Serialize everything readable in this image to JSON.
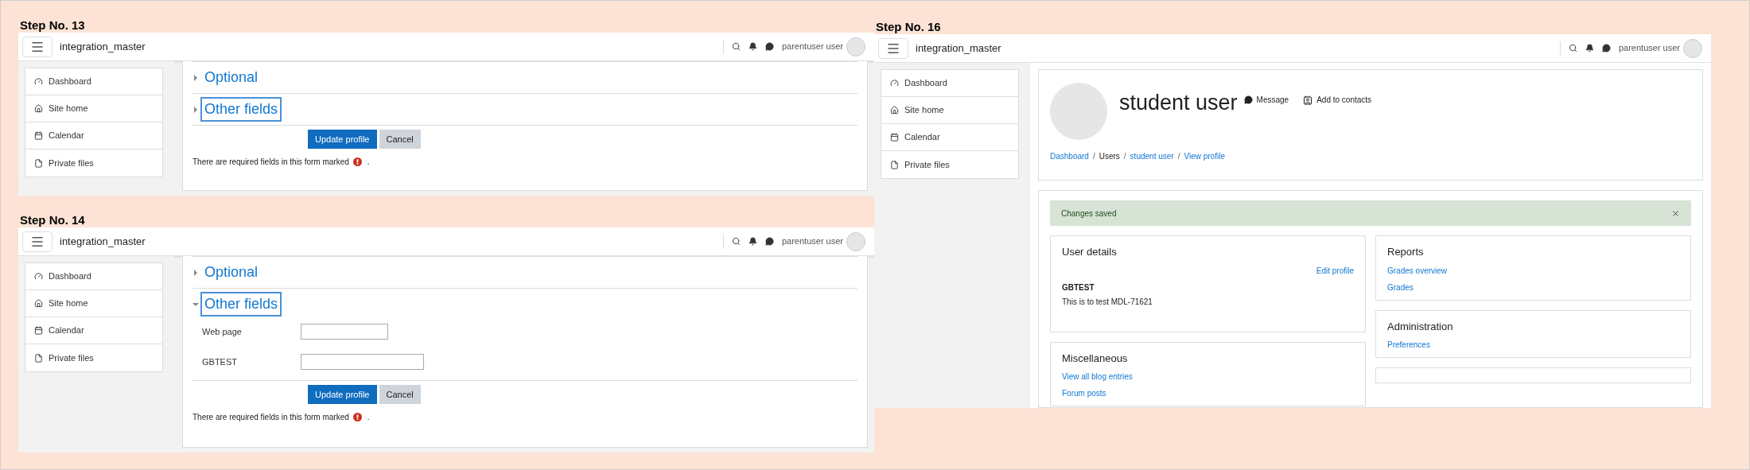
{
  "screenshots": [
    {
      "kind": "form",
      "step_label": "Step No. 13",
      "header": {
        "site_name": "integration_master",
        "user_name": "parentuser user"
      },
      "sidebar": [
        {
          "kind": "dashboard",
          "label": "Dashboard"
        },
        {
          "kind": "home",
          "label": "Site home"
        },
        {
          "kind": "calendar",
          "label": "Calendar"
        },
        {
          "kind": "file",
          "label": "Private files"
        }
      ],
      "form": {
        "sections": [
          {
            "title": "Optional",
            "expanded": false,
            "highlighted": false
          },
          {
            "title": "Other fields",
            "expanded": false,
            "highlighted": true
          }
        ],
        "buttons": [
          {
            "kind": "primary",
            "label": "Update profile"
          },
          {
            "kind": "secondary",
            "label": "Cancel"
          }
        ],
        "note": {
          "text": "There are required fields in this form marked",
          "end": "."
        }
      }
    },
    {
      "kind": "form",
      "step_label": "Step No. 14",
      "header": {
        "site_name": "integration_master",
        "user_name": "parentuser user"
      },
      "sidebar": [
        {
          "kind": "dashboard",
          "label": "Dashboard"
        },
        {
          "kind": "home",
          "label": "Site home"
        },
        {
          "kind": "calendar",
          "label": "Calendar"
        },
        {
          "kind": "file",
          "label": "Private files"
        }
      ],
      "form": {
        "sections": [
          {
            "title": "Optional",
            "expanded": false,
            "highlighted": false
          },
          {
            "title": "Other fields",
            "expanded": true,
            "highlighted": true,
            "fields": [
              {
                "label": "Web page"
              },
              {
                "label": "GBTEST"
              }
            ]
          }
        ],
        "buttons": [
          {
            "kind": "primary",
            "label": "Update profile"
          },
          {
            "kind": "secondary",
            "label": "Cancel"
          }
        ],
        "note": {
          "text": "There are required fields in this form marked",
          "end": "."
        }
      }
    },
    {
      "kind": "profile",
      "step_label": "Step No. 16",
      "header": {
        "site_name": "integration_master",
        "user_name": "parentuser user"
      },
      "sidebar": [
        {
          "kind": "dashboard",
          "label": "Dashboard"
        },
        {
          "kind": "home",
          "label": "Site home"
        },
        {
          "kind": "calendar",
          "label": "Calendar"
        },
        {
          "kind": "file",
          "label": "Private files"
        }
      ],
      "profile": {
        "name": "student user",
        "actions": [
          {
            "kind": "message",
            "label": "Message"
          },
          {
            "kind": "contact",
            "label": "Add to contacts"
          }
        ],
        "breadcrumb": [
          {
            "label": "Dashboard",
            "link": true
          },
          {
            "label": "Users",
            "link": false
          },
          {
            "label": "student user",
            "link": true
          },
          {
            "label": "View profile",
            "link": true
          }
        ],
        "separator": "/",
        "alert": {
          "text": "Changes saved"
        },
        "columns": [
          [
            {
              "title": "User details",
              "edit_link": "Edit profile",
              "entries": [
                {
                  "label": "GBTEST",
                  "value": "This is to test MDL-71621"
                }
              ]
            },
            {
              "title": "Miscellaneous",
              "links": [
                "View all blog entries",
                "Forum posts"
              ]
            }
          ],
          [
            {
              "title": "Reports",
              "links": [
                "Grades overview",
                "Grades"
              ]
            },
            {
              "title": "Administration",
              "links": [
                "Preferences"
              ]
            },
            {}
          ]
        ]
      }
    }
  ]
}
